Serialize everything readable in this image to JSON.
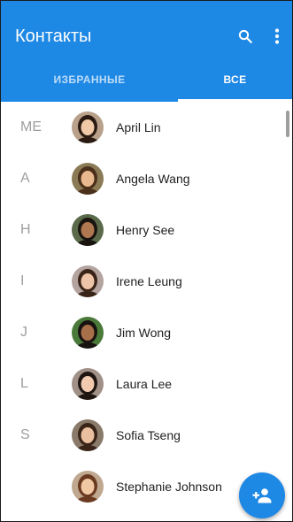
{
  "colors": {
    "primary": "#1e88e5",
    "tab_inactive": "#bcdcf8",
    "letter": "#9e9e9e",
    "name": "#212121"
  },
  "appbar": {
    "title": "Контакты",
    "search_icon": "search-icon",
    "more_icon": "more-vert-icon"
  },
  "tabs": [
    {
      "label": "ИЗБРАННЫЕ",
      "selected": false
    },
    {
      "label": "ВСЕ",
      "selected": true
    }
  ],
  "contacts": [
    {
      "letter": "ME",
      "name": "April Lin",
      "avatar_bg": "#b9a08a",
      "skin": "#f0c9a8",
      "hair": "#2a1a12"
    },
    {
      "letter": "A",
      "name": "Angela Wang",
      "avatar_bg": "#8a7a55",
      "skin": "#e8b88e",
      "hair": "#4a2f1a"
    },
    {
      "letter": "H",
      "name": "Henry See",
      "avatar_bg": "#5a6a4a",
      "skin": "#b07850",
      "hair": "#1a1410"
    },
    {
      "letter": "I",
      "name": "Irene Leung",
      "avatar_bg": "#b4a4a0",
      "skin": "#eec4a8",
      "hair": "#3a2418"
    },
    {
      "letter": "J",
      "name": "Jim Wong",
      "avatar_bg": "#4a7a3a",
      "skin": "#a8704a",
      "hair": "#181210"
    },
    {
      "letter": "L",
      "name": "Laura Lee",
      "avatar_bg": "#a09088",
      "skin": "#f2cab0",
      "hair": "#1e1410"
    },
    {
      "letter": "S",
      "name": "Sofia Tseng",
      "avatar_bg": "#8a7a6a",
      "skin": "#eac0a0",
      "hair": "#3a2418"
    },
    {
      "letter": "",
      "name": "Stephanie Johnson",
      "avatar_bg": "#c0a890",
      "skin": "#f0c8a4",
      "hair": "#6a3a20"
    }
  ],
  "fab": {
    "icon": "add-person-icon"
  }
}
